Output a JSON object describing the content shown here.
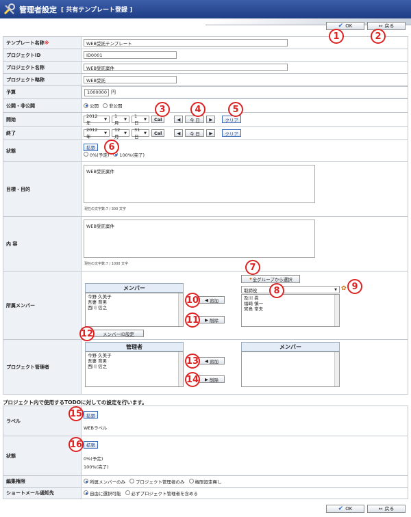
{
  "header": {
    "title": "管理者設定",
    "subtitle": "[ 共有テンプレート登録 ]"
  },
  "toolbar": {
    "ok": "OK",
    "back": "戻る"
  },
  "fields": {
    "template_name": {
      "label": "テンプレート名称",
      "required": "※",
      "value": "WEB受託テンプレート"
    },
    "project_id": {
      "label": "プロジェクトID",
      "value": "ID0001"
    },
    "project_name": {
      "label": "プロジェクト名称",
      "value": "WEB受託案件"
    },
    "project_short": {
      "label": "プロジェクト略称",
      "value": "WEB受託"
    },
    "budget": {
      "label": "予算",
      "value": "1000000",
      "unit": "円"
    },
    "visibility": {
      "label": "公開・非公開",
      "options": [
        "公開",
        "非公開"
      ],
      "selected": "公開"
    },
    "start": {
      "label": "開始",
      "year": "2012年",
      "month": "1月",
      "day": "1日",
      "cal": "Cal",
      "today": "今 日",
      "clear": "クリア"
    },
    "end": {
      "label": "終了",
      "year": "2012年",
      "month": "12月",
      "day": "31日",
      "cal": "Cal",
      "today": "今 日",
      "clear": "クリア"
    },
    "status": {
      "label": "状態",
      "expand": "拡張",
      "options": [
        "0%(予定)",
        "100%(完了)"
      ],
      "selected": "100%(完了)"
    },
    "goal": {
      "label": "目標・目的",
      "value": "WEB受託案件",
      "counter": "現在の文字数:7 / 300 文字"
    },
    "content": {
      "label": "内 容",
      "value": "WEB受託案件",
      "counter": "現在の文字数:7 / 1000 文字"
    },
    "members": {
      "label": "所属メンバー",
      "header": "メンバー",
      "list": [
        "今野 久美子",
        "吾妻 育男",
        "西川 信之"
      ],
      "add": "追加",
      "remove": "削除",
      "member_id": "メンバーID設定",
      "group_select": "全グループから選択",
      "group": "取締役",
      "candidates": [
        "及川 眞",
        "福崎 慎一",
        "宮島 常夫"
      ]
    },
    "managers": {
      "label": "プロジェクト管理者",
      "header": "管理者",
      "other_header": "メンバー",
      "list": [
        "今野 久美子",
        "吾妻 育男",
        "西川 信之"
      ],
      "add": "追加",
      "remove": "削除"
    }
  },
  "todo": {
    "heading": "プロジェクト内で使用するTODOに対しての設定を行います。",
    "label_row": {
      "label": "ラベル",
      "expand": "拡張",
      "value": "WEBラベル"
    },
    "status_row": {
      "label": "状態",
      "expand": "拡張",
      "values": [
        "0%(予定)",
        "100%(完了)"
      ]
    },
    "edit_perm": {
      "label": "編集権限",
      "options": [
        "所属メンバーのみ",
        "プロジェクト管理者のみ",
        "権限設定無し"
      ],
      "selected": "所属メンバーのみ"
    },
    "mail": {
      "label": "ショートメール通知先",
      "options": [
        "自由に選択可能",
        "必ずプロジェクト管理者を含める"
      ],
      "selected": "自由に選択可能"
    }
  },
  "annotations": [
    "1",
    "2",
    "3",
    "4",
    "5",
    "6",
    "7",
    "8",
    "9",
    "10",
    "11",
    "12",
    "13",
    "14",
    "15",
    "16"
  ],
  "colors": {
    "title_bar": "#1e3d86",
    "annotation": "#dd2222",
    "label_bg": "#eef1f5"
  }
}
